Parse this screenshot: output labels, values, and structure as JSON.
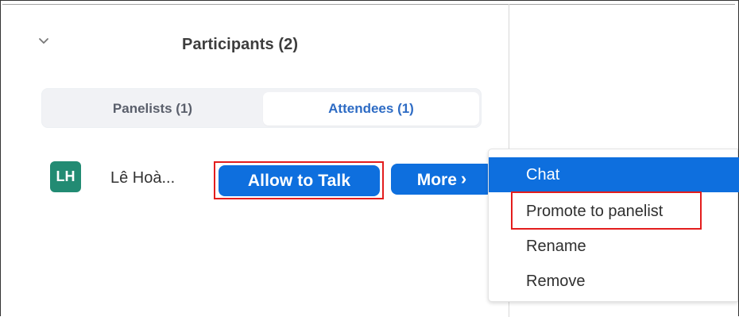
{
  "header": {
    "title": "Participants (2)"
  },
  "tabs": [
    {
      "label": "Panelists (1)"
    },
    {
      "label": "Attendees (1)"
    }
  ],
  "participant": {
    "initials": "LH",
    "name": "Lê Hoà..."
  },
  "actions": {
    "allow_to_talk": "Allow to Talk",
    "more": "More",
    "more_chevron": "›"
  },
  "menu": {
    "items": [
      {
        "label": "Chat"
      },
      {
        "label": "Promote to panelist"
      },
      {
        "label": "Rename"
      },
      {
        "label": "Remove"
      }
    ]
  },
  "colors": {
    "primary_blue": "#0e6fde",
    "tab_blue": "#2d6bc4",
    "avatar_green": "#228b73",
    "highlight_red": "#e31d1d",
    "text_dark": "#333333"
  },
  "icons": {
    "collapse": "chevron-down-icon",
    "more": "chevron-right-icon"
  }
}
